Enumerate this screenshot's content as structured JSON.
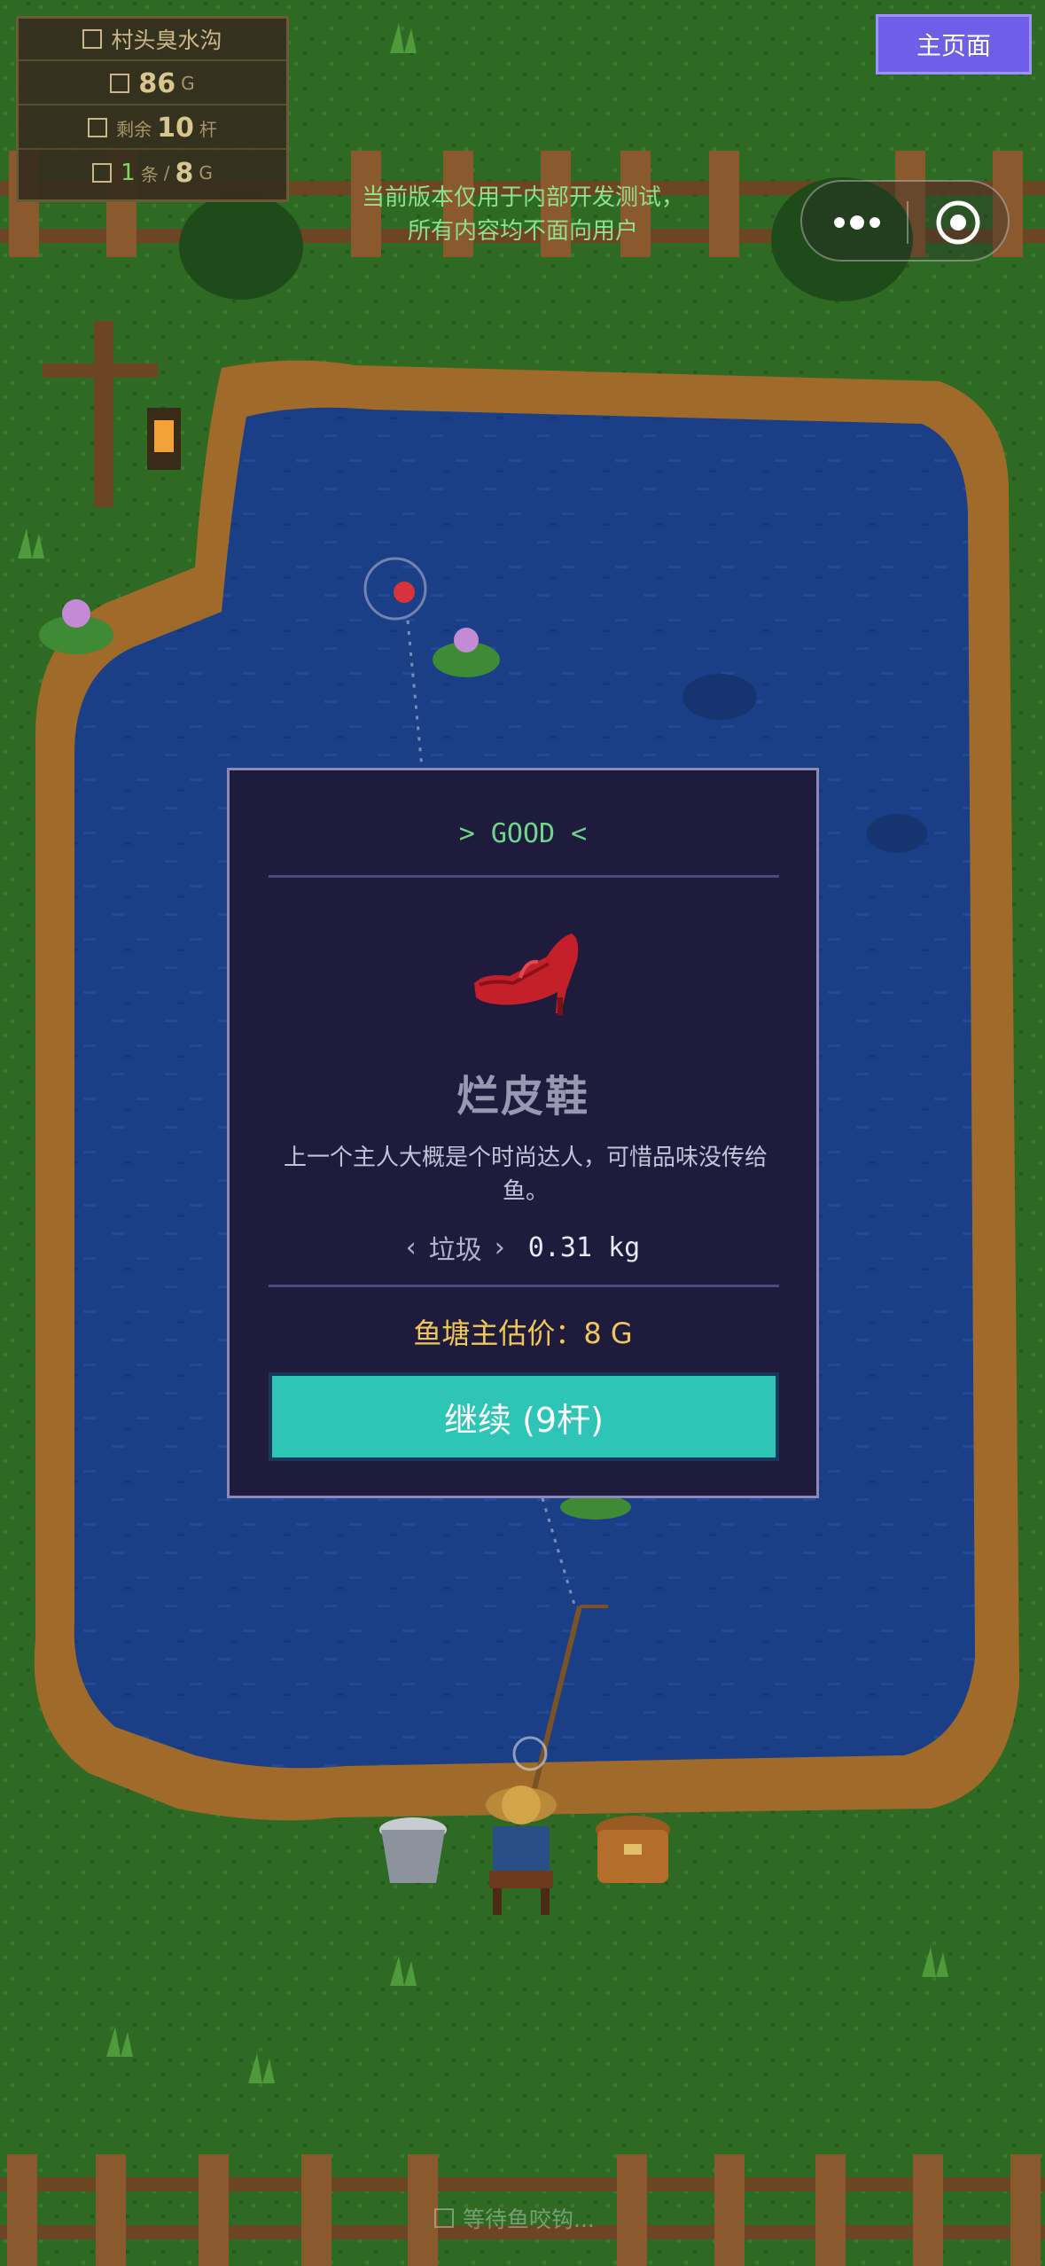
{
  "hud": {
    "location": "村头臭水沟",
    "gold": "86",
    "gold_unit": "G",
    "remaining_label": "剩余",
    "remaining_count": "10",
    "remaining_unit": "杆",
    "caught_count": "1",
    "caught_unit": "条",
    "caught_value": "8",
    "caught_value_unit": "G"
  },
  "header": {
    "home_button": "主页面",
    "notice_line1": "当前版本仅用于内部开发测试，",
    "notice_line2": "所有内容均不面向用户"
  },
  "icons": [
    "more-icon",
    "target-icon",
    "red-high-heel-icon",
    "lantern-icon",
    "bucket-icon",
    "basket-icon",
    "lily-pad-icon",
    "fisherman-icon"
  ],
  "result": {
    "quality": "> GOOD <",
    "item_name": "烂皮鞋",
    "description": "上一个主人大概是个时尚达人，可惜品味没传给鱼。",
    "category": "垃圾",
    "category_left": "‹",
    "category_right": "›",
    "weight": "0.31 kg",
    "price_text": "鱼塘主估价：8 G",
    "continue_button": "继续 (9杆)"
  },
  "status": {
    "text": "等待鱼咬钩..."
  },
  "colors": {
    "grass": "#2f6a25",
    "water": "#1b3f86",
    "card_bg": "#1e1b3d",
    "button_teal": "#2ec4b6",
    "home_purple": "#6f5fe8",
    "quality_green": "#6fd58a",
    "price_gold": "#f0c85a"
  }
}
